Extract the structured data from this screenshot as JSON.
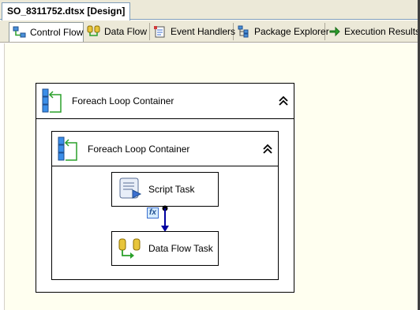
{
  "document_tab": {
    "title": "SO_8311752.dtsx [Design]"
  },
  "designer_tabs": [
    {
      "label": "Control Flow",
      "icon": "control-flow-icon",
      "active": true
    },
    {
      "label": "Data Flow",
      "icon": "data-flow-icon",
      "active": false
    },
    {
      "label": "Event Handlers",
      "icon": "event-handlers-icon",
      "active": false
    },
    {
      "label": "Package Explorer",
      "icon": "package-explorer-icon",
      "active": false
    },
    {
      "label": "Execution Results",
      "icon": "execution-results-icon",
      "active": false
    }
  ],
  "canvas": {
    "outer_container": {
      "title": "Foreach Loop Container",
      "icon": "foreach-loop-icon",
      "collapse_icon": "chevron-double-up-icon"
    },
    "inner_container": {
      "title": "Foreach Loop Container",
      "icon": "foreach-loop-icon",
      "collapse_icon": "chevron-double-up-icon"
    },
    "tasks": [
      {
        "label": "Script Task",
        "icon": "script-task-icon"
      },
      {
        "label": "Data Flow Task",
        "icon": "data-flow-task-icon"
      }
    ],
    "precedence_constraint": {
      "icon": "fx-expression-icon",
      "color": "#0000a0"
    }
  },
  "colors": {
    "chrome": "#ece9d8",
    "surface": "#fffff0",
    "connector": "#0000a0",
    "container_icon_blue": "#3b8ee8",
    "container_icon_green": "#2aa02a"
  }
}
